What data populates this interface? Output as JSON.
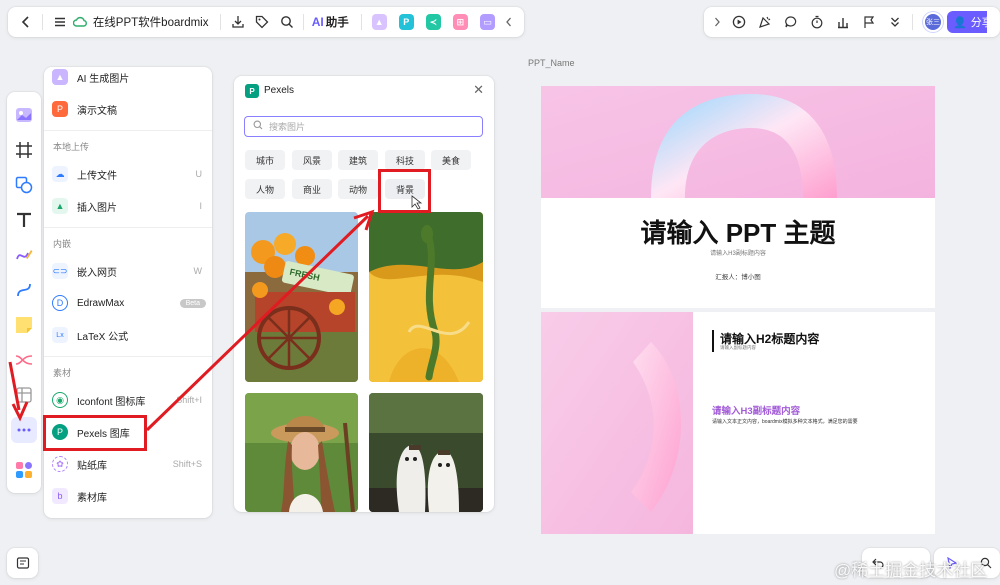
{
  "toolbar": {
    "doc_title": "在线PPT软件boardmix",
    "ai_label": "AI助手",
    "ai_mark": "AI"
  },
  "share": {
    "label": "分享",
    "avatar_text": "张三"
  },
  "menu": {
    "top_items": [
      {
        "label": "AI 生成图片"
      },
      {
        "label": "演示文稿"
      }
    ],
    "section_local": "本地上传",
    "local_items": [
      {
        "label": "上传文件",
        "shortcut": "U"
      },
      {
        "label": "插入图片",
        "shortcut": "I"
      }
    ],
    "section_embed": "内嵌",
    "embed_items": [
      {
        "label": "嵌入网页",
        "shortcut": "W"
      },
      {
        "label": "EdrawMax",
        "badge": "Beta"
      },
      {
        "label": "LaTeX 公式"
      }
    ],
    "section_material": "素材",
    "material_items": [
      {
        "label": "Iconfont 图标库",
        "shortcut": "Shift+I"
      },
      {
        "label": "Pexels 图库"
      },
      {
        "label": "贴纸库",
        "shortcut": "Shift+S"
      },
      {
        "label": "素材库"
      }
    ]
  },
  "pexels": {
    "title": "Pexels",
    "logo": "P",
    "search_placeholder": "搜索图片",
    "tags": [
      "城市",
      "风景",
      "建筑",
      "科技",
      "美食",
      "人物",
      "商业",
      "动物",
      "背景"
    ],
    "photo_label": "FRESH"
  },
  "canvas": {
    "ppt_name": "PPT_Name",
    "slide1": {
      "title": "请输入 PPT 主题",
      "subtitle": "请输入H3副标题内容",
      "presenter": "汇报人：博小图"
    },
    "slide2": {
      "h2": "请输入H2标题内容",
      "h2_sub": "请输入副标题内容",
      "h3": "请输入H3副标题内容",
      "body": "请输入文本正文内容，boardmix模拟多种文本格式，满足您的需要"
    }
  },
  "watermark": "@稀土掘金技术社区",
  "colors": {
    "accent": "#6a5cff",
    "annotation": "#e01b22",
    "pexels": "#05a081"
  }
}
